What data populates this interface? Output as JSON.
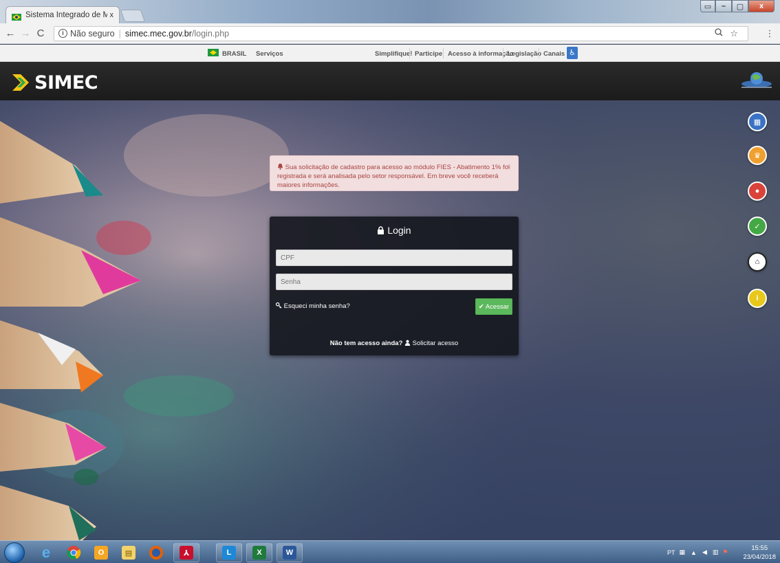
{
  "browser": {
    "tab_title": "Sistema Integrado de Mo",
    "tab_close": "x",
    "security_label": "Não seguro",
    "url_host": "simec.mec.gov.br",
    "url_path": "/login.php",
    "icons": [
      "back-icon",
      "forward-icon",
      "reload-icon",
      "info-icon",
      "zoom-icon",
      "star-icon",
      "menu-icon"
    ]
  },
  "govbar": {
    "brasil": "BRASIL",
    "servicos": "Serviços",
    "simplifique": "Simplifique!",
    "participe": "Participe",
    "acesso_info": "Acesso à informação",
    "legislacao": "Legislação",
    "canais": "Canais"
  },
  "header": {
    "logo_text": "SIMEC"
  },
  "alert": {
    "message": "Sua solicitação de cadastro para acesso ao módulo FIES - Abatimento 1% foi registrada e será analisada pelo setor responsável. Em breve você receberá maiores informações.",
    "close": "×"
  },
  "login": {
    "title": "Login",
    "cpf_placeholder": "CPF",
    "senha_placeholder": "Senha",
    "forgot": "Esqueci minha senha?",
    "submit": "Acessar",
    "no_access": "Não tem acesso ainda?",
    "request_access": "Solicitar acesso"
  },
  "side_icons": [
    {
      "name": "apps-icon",
      "color": "#3a72c4",
      "glyph": "▦"
    },
    {
      "name": "trophy-icon",
      "color": "#f0a030",
      "glyph": "♛"
    },
    {
      "name": "chat-icon",
      "color": "#d9433a",
      "glyph": "●"
    },
    {
      "name": "checkbox-icon",
      "color": "#44a845",
      "glyph": "✓"
    },
    {
      "name": "institution-icon",
      "color": "#ffffff",
      "glyph": "⌂"
    },
    {
      "name": "info-icon",
      "color": "#e8c81a",
      "glyph": "i"
    }
  ],
  "taskbar": {
    "lang": "PT",
    "time": "15:55",
    "date": "23/04/2018",
    "apps": [
      "ie-icon",
      "chrome-icon",
      "outlook-icon",
      "explorer-icon",
      "firefox-icon",
      "acrobat-icon",
      "lync-icon",
      "excel-icon",
      "word-icon"
    ]
  }
}
